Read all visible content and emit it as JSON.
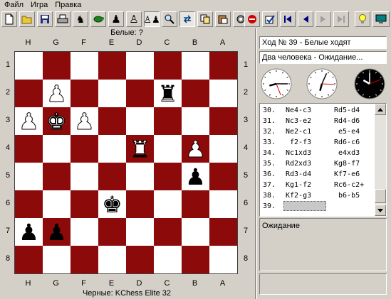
{
  "menu": {
    "items": [
      "Файл",
      "Игра",
      "Правка"
    ]
  },
  "toolbar": {
    "buttons": [
      {
        "name": "new-game-button",
        "icon": "new-document-icon"
      },
      {
        "name": "open-file-button",
        "icon": "open-folder-icon"
      },
      {
        "name": "save-file-button",
        "icon": "floppy-disk-icon"
      },
      {
        "name": "print-button",
        "icon": "printer-icon"
      },
      {
        "name": "undo-move-button",
        "icon": "undo-icon"
      },
      {
        "name": "turtle-button",
        "icon": "turtle-icon"
      },
      {
        "name": "black-pawn-button",
        "icon": "black-pawn-icon"
      },
      {
        "name": "white-pawn-button",
        "icon": "white-pawn-icon"
      },
      {
        "name": "pawns-button",
        "icon": "pawns-icon"
      },
      {
        "name": "hint-button",
        "icon": "magnifier-icon"
      },
      {
        "name": "swap-button",
        "icon": "swap-icon"
      },
      {
        "name": "copy-button",
        "icon": "copy-icon"
      },
      {
        "name": "paste-button",
        "icon": "paste-icon"
      },
      {
        "name": "settings-button",
        "icon": "gear-icon"
      },
      {
        "name": "stop-button",
        "icon": "stop-icon"
      },
      {
        "name": "check-button",
        "icon": "checklist-icon"
      },
      {
        "name": "first-move-button",
        "icon": "skip-start-icon"
      },
      {
        "name": "previous-move-button",
        "icon": "triangle-left-icon"
      },
      {
        "name": "next-move-button",
        "icon": "triangle-right-icon"
      },
      {
        "name": "last-move-button",
        "icon": "skip-end-icon"
      },
      {
        "name": "idea-button",
        "icon": "lightbulb-icon"
      },
      {
        "name": "computer-button",
        "icon": "monitor-icon"
      }
    ]
  },
  "players": {
    "white": "Белые: ?",
    "black": "Черные: KChess Elite 32"
  },
  "board": {
    "files": [
      "H",
      "G",
      "F",
      "E",
      "D",
      "C",
      "B",
      "A"
    ],
    "ranks": [
      "1",
      "2",
      "3",
      "4",
      "5",
      "6",
      "7",
      "8"
    ],
    "light_color": "#ffffff",
    "dark_color": "#8c0a0a",
    "pieces": [
      {
        "file": "G",
        "rank": "2",
        "piece": "pawn",
        "color": "white"
      },
      {
        "file": "C",
        "rank": "2",
        "piece": "rook",
        "color": "black"
      },
      {
        "file": "H",
        "rank": "3",
        "piece": "pawn",
        "color": "white"
      },
      {
        "file": "G",
        "rank": "3",
        "piece": "king",
        "color": "white"
      },
      {
        "file": "F",
        "rank": "3",
        "piece": "pawn",
        "color": "white"
      },
      {
        "file": "D",
        "rank": "4",
        "piece": "rook",
        "color": "white"
      },
      {
        "file": "B",
        "rank": "4",
        "piece": "pawn",
        "color": "white"
      },
      {
        "file": "B",
        "rank": "5",
        "piece": "pawn",
        "color": "black"
      },
      {
        "file": "E",
        "rank": "6",
        "piece": "king",
        "color": "black"
      },
      {
        "file": "H",
        "rank": "7",
        "piece": "pawn",
        "color": "black"
      },
      {
        "file": "G",
        "rank": "7",
        "piece": "pawn",
        "color": "black"
      }
    ]
  },
  "panel": {
    "move_text": "Ход № 39 - Белые ходят",
    "mode_text": "Два человека - Ожидание..."
  },
  "clocks": [
    {
      "name": "white-clock-icon",
      "face": "#ffffff",
      "hands": "#000000",
      "hour": 8.5,
      "minute": 15
    },
    {
      "name": "move-clock-icon",
      "face": "#ffffff",
      "hands": "#000000",
      "hour": 6.5,
      "minute": 4
    },
    {
      "name": "black-clock-icon",
      "face": "#000000",
      "hands": "#ffffff",
      "hour": 10,
      "minute": 0
    }
  ],
  "moves": [
    {
      "num": "30.",
      "white": "Ne4-c3",
      "black": "Rd5-d4"
    },
    {
      "num": "31.",
      "white": "Nc3-e2",
      "black": "Rd4-d6"
    },
    {
      "num": "32.",
      "white": "Ne2-c1",
      "black": " e5-e4"
    },
    {
      "num": "33.",
      "white": " f2-f3",
      "black": "Rd6-c6"
    },
    {
      "num": "34.",
      "white": "Nc1xd3",
      "black": " e4xd3"
    },
    {
      "num": "35.",
      "white": "Rd2xd3",
      "black": "Kg8-f7"
    },
    {
      "num": "36.",
      "white": "Rd3-d4",
      "black": "Kf7-e6"
    },
    {
      "num": "37.",
      "white": "Kg1-f2",
      "black": "Rc6-c2+"
    },
    {
      "num": "38.",
      "white": "Kf2-g3",
      "black": " b6-b5"
    },
    {
      "num": "39.",
      "white": "",
      "black": ""
    }
  ],
  "status": {
    "text": "Ожидание"
  }
}
